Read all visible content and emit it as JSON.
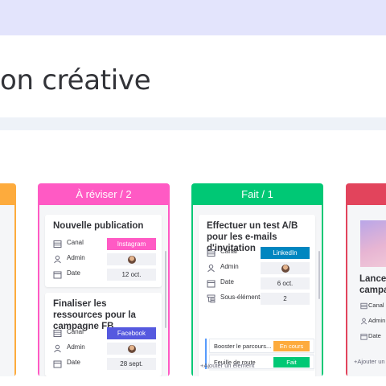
{
  "page": {
    "title": "on créative"
  },
  "columns": {
    "pink": {
      "header": "À réviser / 2",
      "cards": [
        {
          "title": "Nouvelle publication",
          "canal_label": "Canal",
          "canal_value": "Instagram",
          "canal_color": "#ff5ac4",
          "admin_label": "Admin",
          "date_label": "Date",
          "date_value": "12 oct."
        },
        {
          "title": "Finaliser les ressources pour la campagne FB",
          "canal_label": "Canal",
          "canal_value": "Facebook",
          "canal_color": "#5559df",
          "admin_label": "Admin",
          "date_label": "Date",
          "date_value": "28 sept."
        }
      ]
    },
    "green": {
      "header": "Fait / 1",
      "card": {
        "title": "Effectuer un test A/B pour les e-mails d'invitation",
        "canal_label": "Canal",
        "canal_value": "LinkedIn",
        "canal_color": "#0086c0",
        "admin_label": "Admin",
        "date_label": "Date",
        "date_value": "6 oct.",
        "subitems_label": "Sous-éléments",
        "subitems_value": "2"
      },
      "subitems": [
        {
          "name": "Booster le parcours...",
          "status": "En cours",
          "color": "#fdab3d"
        },
        {
          "name": "Feuille de route",
          "status": "Fait",
          "color": "#00c875"
        }
      ],
      "add_item": "+Ajouter un élément"
    },
    "red": {
      "card": {
        "title_line1": "Lancem",
        "title_line2": "campag",
        "canal_label": "Canal",
        "admin_label": "Admin",
        "date_label": "Date"
      },
      "add_item": "+Ajouter un é"
    }
  },
  "icons": {
    "canal": "table-icon",
    "admin": "person-icon",
    "date": "calendar-icon",
    "subitems": "subitems-icon"
  }
}
